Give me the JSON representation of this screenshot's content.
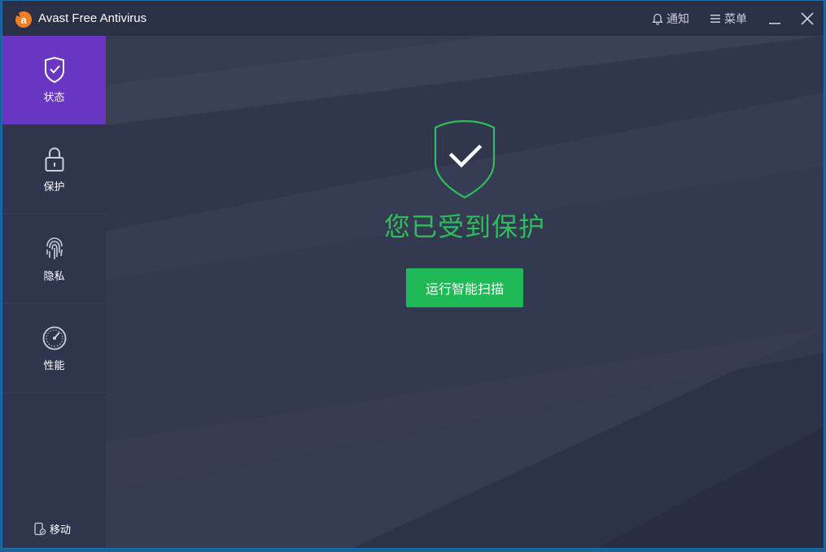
{
  "window": {
    "title": "Avast Free Antivirus"
  },
  "titlebar": {
    "notifications_label": "通知",
    "menu_label": "菜单"
  },
  "sidebar": {
    "items": [
      {
        "label": "状态",
        "icon": "shield-check-icon",
        "active": true
      },
      {
        "label": "保护",
        "icon": "lock-icon",
        "active": false
      },
      {
        "label": "隐私",
        "icon": "fingerprint-icon",
        "active": false
      },
      {
        "label": "性能",
        "icon": "speedometer-icon",
        "active": false
      }
    ],
    "mobile_label": "移动"
  },
  "main": {
    "status_text": "您已受到保护",
    "scan_button_label": "运行智能扫描"
  },
  "colors": {
    "accent_purple": "#6935c3",
    "success_green": "#2ebd59",
    "button_green": "#1fb955",
    "logo_orange": "#f47d20"
  }
}
